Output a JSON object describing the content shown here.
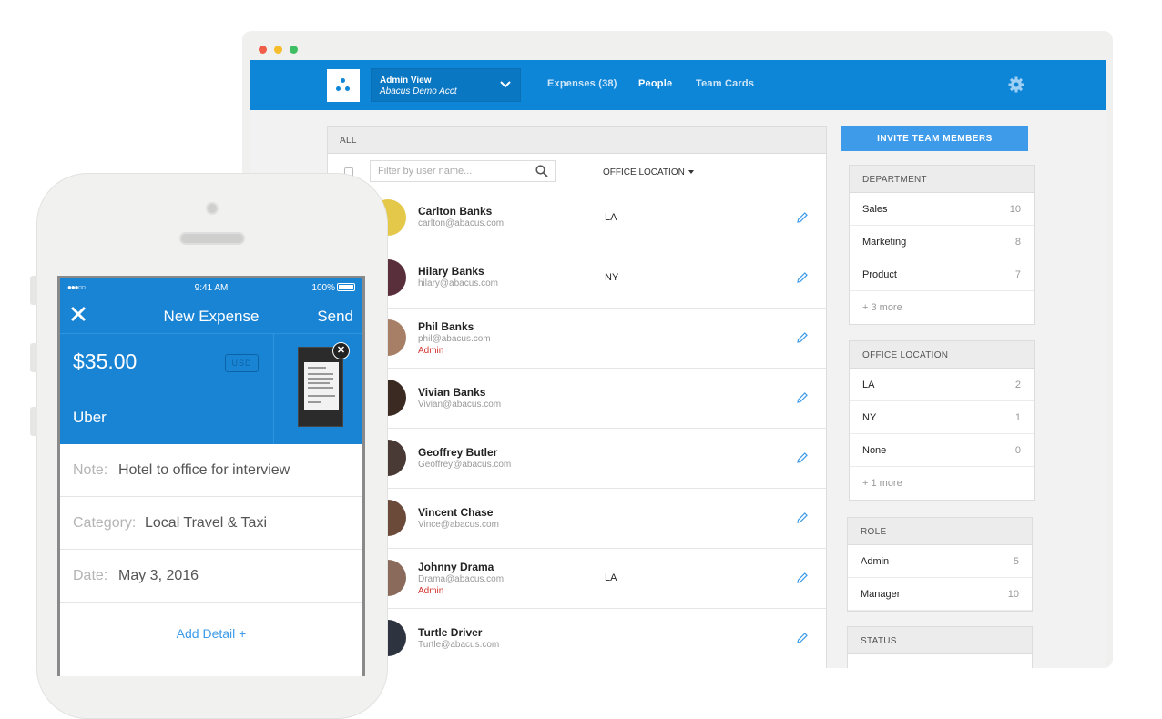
{
  "app": {
    "account_view": "Admin View",
    "account_name": "Abacus Demo Acct",
    "nav": [
      {
        "label": "Expenses (38)",
        "active": false
      },
      {
        "label": "People",
        "active": true
      },
      {
        "label": "Team Cards",
        "active": false
      }
    ]
  },
  "people": {
    "header": "ALL",
    "search_placeholder": "Filter by user name...",
    "office_column": "OFFICE LOCATION",
    "rows": [
      {
        "name": "Carlton Banks",
        "email": "carlton@abacus.com",
        "role": "",
        "location": "LA"
      },
      {
        "name": "Hilary Banks",
        "email": "hilary@abacus.com",
        "role": "",
        "location": "NY"
      },
      {
        "name": "Phil Banks",
        "email": "phil@abacus.com",
        "role": "Admin",
        "location": ""
      },
      {
        "name": "Vivian Banks",
        "email": "Vivian@abacus.com",
        "role": "",
        "location": ""
      },
      {
        "name": "Geoffrey Butler",
        "email": "Geoffrey@abacus.com",
        "role": "",
        "location": ""
      },
      {
        "name": "Vincent Chase",
        "email": "Vince@abacus.com",
        "role": "",
        "location": ""
      },
      {
        "name": "Johnny Drama",
        "email": "Drama@abacus.com",
        "role": "Admin",
        "location": "LA"
      },
      {
        "name": "Turtle Driver",
        "email": "Turtle@abacus.com",
        "role": "",
        "location": ""
      }
    ]
  },
  "sidebar": {
    "invite_label": "INVITE TEAM MEMBERS",
    "department": {
      "title": "DEPARTMENT",
      "items": [
        {
          "label": "Sales",
          "count": "10"
        },
        {
          "label": "Marketing",
          "count": "8"
        },
        {
          "label": "Product",
          "count": "7"
        }
      ],
      "more": "+ 3 more"
    },
    "office": {
      "title": "OFFICE LOCATION",
      "items": [
        {
          "label": "LA",
          "count": "2"
        },
        {
          "label": "NY",
          "count": "1"
        },
        {
          "label": "None",
          "count": "0"
        }
      ],
      "more": "+ 1 more"
    },
    "role": {
      "title": "ROLE",
      "items": [
        {
          "label": "Admin",
          "count": "5"
        },
        {
          "label": "Manager",
          "count": "10"
        }
      ]
    },
    "status": {
      "title": "STATUS"
    }
  },
  "phone": {
    "time": "9:41 AM",
    "battery": "100%",
    "title": "New Expense",
    "send": "Send",
    "amount": "$35.00",
    "currency": "USD",
    "merchant": "Uber",
    "note_label": "Note:",
    "note_value": "Hotel to office for interview",
    "category_label": "Category:",
    "category_value": "Local Travel & Taxi",
    "date_label": "Date:",
    "date_value": "May 3, 2016",
    "add_detail": "Add Detail +"
  },
  "colors": {
    "brand_blue": "#0e86d8",
    "admin_red": "#d0342c",
    "link_blue": "#3d9be9"
  }
}
